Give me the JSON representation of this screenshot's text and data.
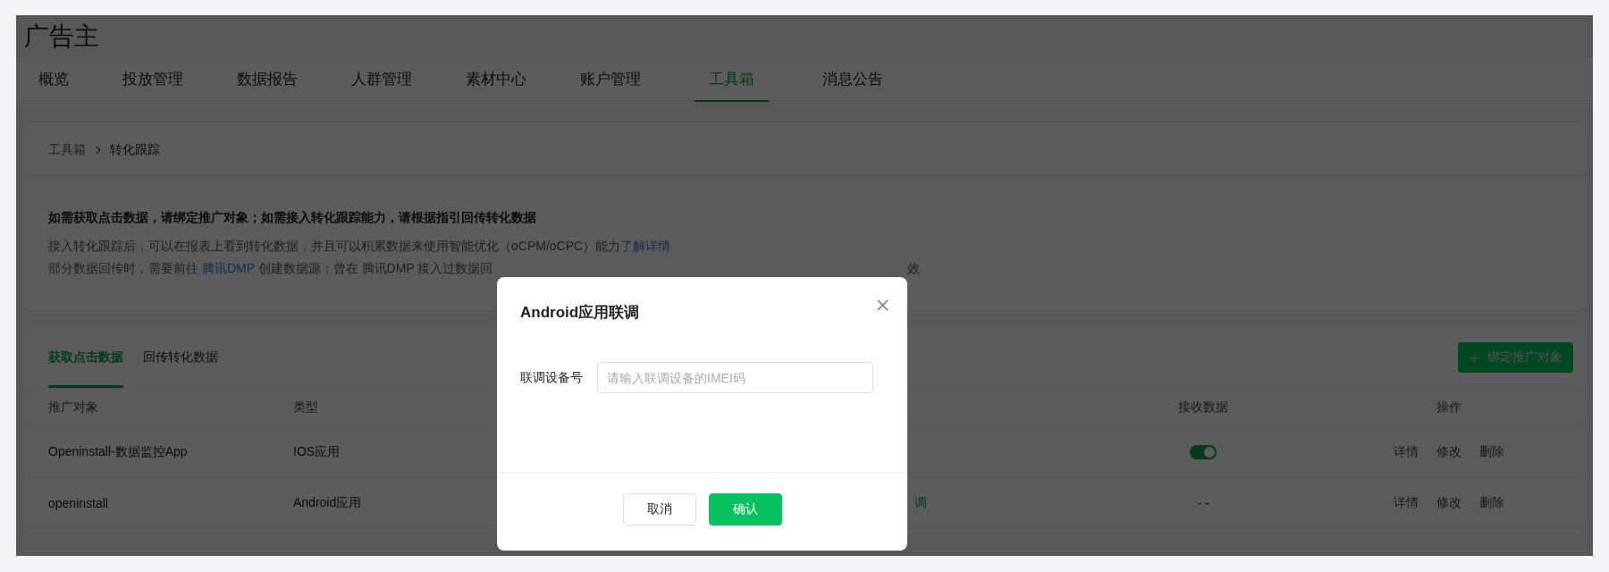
{
  "header": {
    "title": "广告主"
  },
  "nav": [
    {
      "label": "概览",
      "selected": false
    },
    {
      "label": "投放管理",
      "selected": false
    },
    {
      "label": "数据报告",
      "selected": false
    },
    {
      "label": "人群管理",
      "selected": false
    },
    {
      "label": "素材中心",
      "selected": false
    },
    {
      "label": "账户管理",
      "selected": false
    },
    {
      "label": "工具箱",
      "selected": true
    },
    {
      "label": "消息公告",
      "selected": false
    }
  ],
  "breadcrumb": [
    "工具箱",
    "转化跟踪"
  ],
  "notice": {
    "heading": "如需获取点击数据，请绑定推广对象；如需接入转化跟踪能力，请根据指引回传转化数据",
    "line_1": {
      "text": "接入转化跟踪后，可以在报表上看到转化数据，并且可以积累数据来使用智能优化（oCPM/oCPC）能力",
      "link": "了解详情"
    },
    "line_2": {
      "before": "部分数据回传时，需要前往 ",
      "link": "腾讯DMP",
      "after": " 创建数据源；曾在 腾讯DMP 接入过数据回",
      "tail": "效"
    }
  },
  "tabs": [
    {
      "label": "获取点击数据",
      "selected": true
    },
    {
      "label": "回传转化数据",
      "selected": false
    }
  ],
  "bind_button": {
    "label": "绑定推广对象"
  },
  "table": {
    "columns": [
      "推广对象",
      "类型",
      "接收数据",
      "操作"
    ],
    "rows": [
      {
        "target": "Openinstall-数据监控App",
        "type": "IOS应用",
        "receive": {
          "kind": "toggle",
          "on": true
        },
        "actions": [
          "详情",
          "修改",
          "删除"
        ]
      },
      {
        "target": "openinstall",
        "type": "Android应用",
        "column_3": "调",
        "receive": {
          "kind": "text",
          "text": "- -"
        },
        "actions": [
          "详情",
          "修改",
          "删除"
        ]
      }
    ]
  },
  "dialog": {
    "title": "Android应用联调",
    "field_label": "联调设备号",
    "placeholder": "请输入联调设备的IMEI码",
    "buttons": [
      {
        "kind": "secondary",
        "label": "取消"
      },
      {
        "kind": "primary",
        "label": "确认"
      }
    ]
  }
}
